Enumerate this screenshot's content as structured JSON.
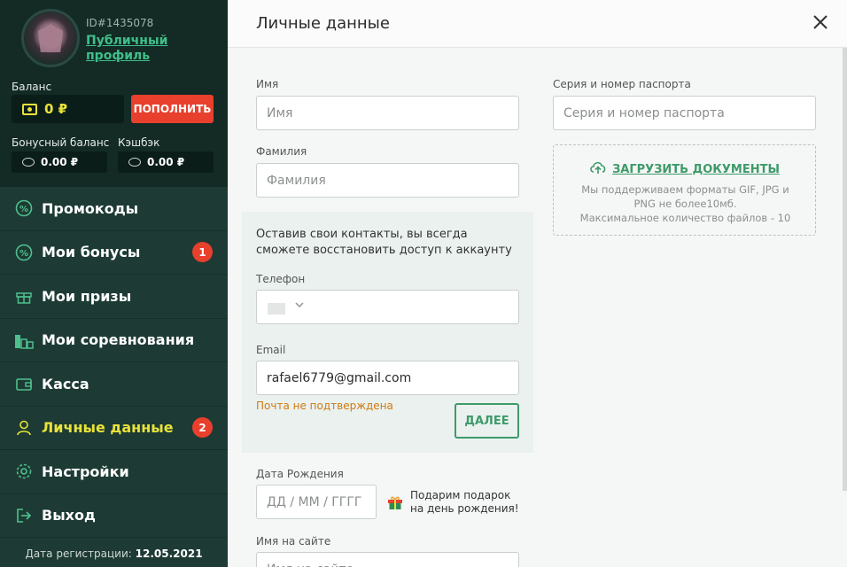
{
  "profile": {
    "id_text": "ID#1435078",
    "public_profile_link": "Публичный профиль"
  },
  "balance": {
    "label": "Баланс",
    "value": "0 ₽",
    "topup_label": "ПОПОЛНИТЬ"
  },
  "bonus": {
    "label": "Бонусный баланс",
    "value": "0.00 ₽"
  },
  "cashback": {
    "label": "Кэшбэк",
    "value": "0.00 ₽"
  },
  "menu": {
    "items": [
      {
        "label": "Промокоды",
        "icon": "percent-icon"
      },
      {
        "label": "Мои бонусы",
        "icon": "percent-icon",
        "badge": "1"
      },
      {
        "label": "Мои призы",
        "icon": "gift-icon"
      },
      {
        "label": "Мои соревнования",
        "icon": "podium-icon"
      },
      {
        "label": "Касса",
        "icon": "wallet-icon"
      },
      {
        "label": "Личные данные",
        "icon": "user-icon",
        "badge": "2",
        "active": true
      },
      {
        "label": "Настройки",
        "icon": "gear-icon"
      },
      {
        "label": "Выход",
        "icon": "logout-icon"
      }
    ]
  },
  "registration": {
    "label": "Дата регистрации:",
    "date": "12.05.2021"
  },
  "page": {
    "title": "Личные данные"
  },
  "form": {
    "first_name": {
      "label": "Имя",
      "placeholder": "Имя"
    },
    "last_name": {
      "label": "Фамилия",
      "placeholder": "Фамилия"
    },
    "contacts_text": "Оставив свои контакты, вы всегда сможете восстановить доступ к аккаунту",
    "phone": {
      "label": "Телефон"
    },
    "email": {
      "label": "Email",
      "value": "rafael6779@gmail.com",
      "warning": "Почта не подтверждена"
    },
    "next_label": "ДАЛЕЕ",
    "birthdate": {
      "label": "Дата Рождения",
      "placeholder": "ДД / ММ / ГГГГ"
    },
    "gift_text": "Подарим подарок на день рождения!",
    "nickname": {
      "label": "Имя на сайте",
      "placeholder": "Имя на сайте"
    },
    "passport": {
      "label": "Серия и номер паспорта",
      "placeholder": "Серия и номер паспорта"
    },
    "upload": {
      "link": "ЗАГРУЗИТЬ ДОКУМЕНТЫ",
      "hint1": "Мы поддерживаем форматы GIF, JPG и PNG не более10мб.",
      "hint2": "Максимальное количество файлов - 10"
    }
  },
  "colors": {
    "sidebar": "#1d3b34",
    "accent_green": "#3f9a6a",
    "accent_yellow": "#e9e23a",
    "danger": "#e8402c"
  }
}
